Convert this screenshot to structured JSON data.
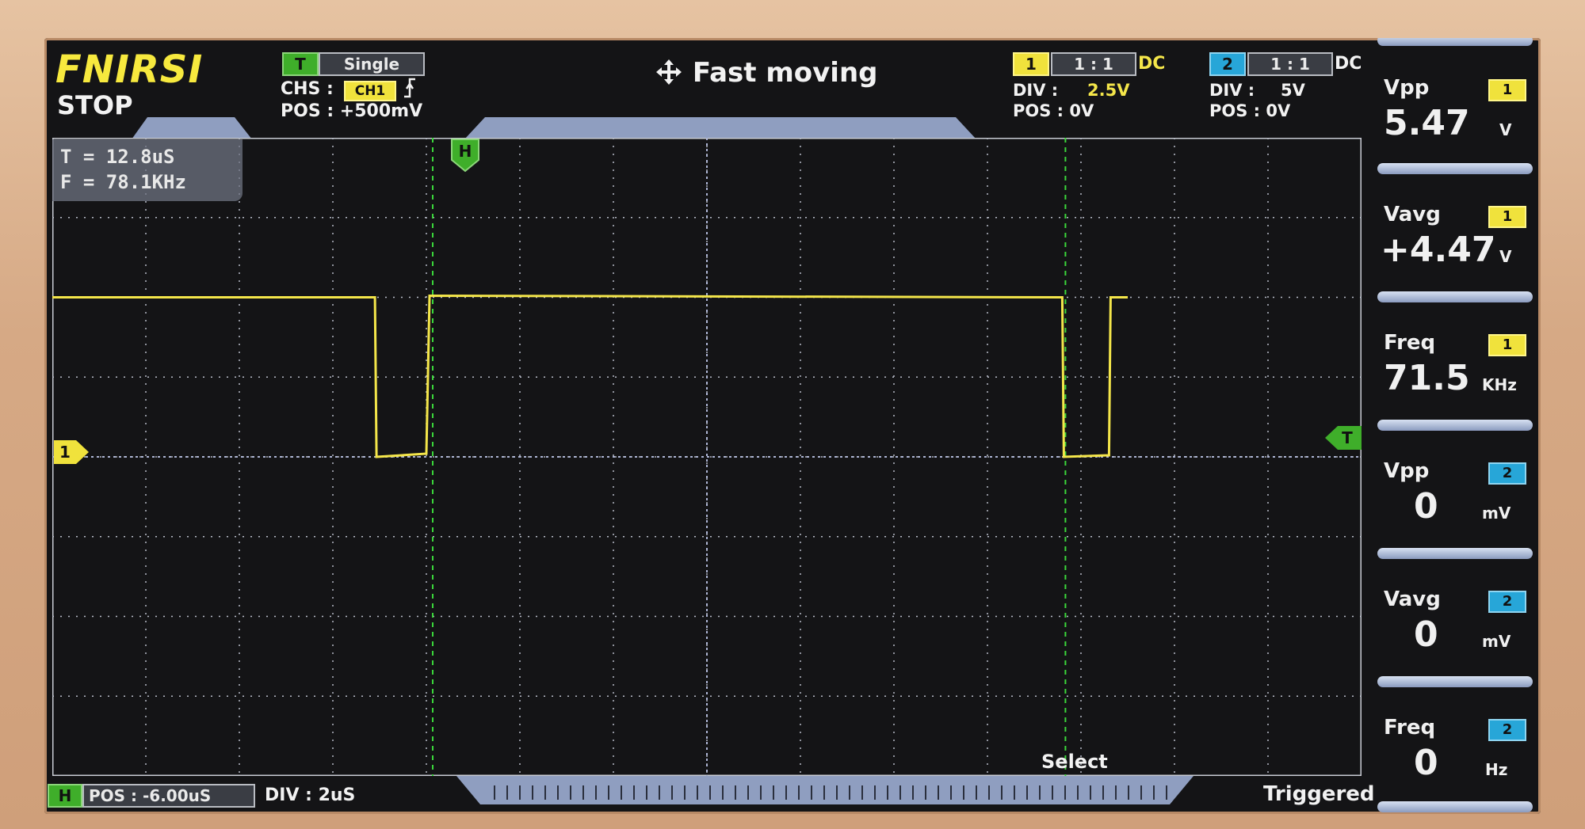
{
  "header": {
    "brand": "FNIRSI",
    "run_state": "STOP",
    "center_title": "Fast moving",
    "center_icon": "move-arrows-icon"
  },
  "trigger": {
    "tag": "T",
    "mode": "Single",
    "source_label": "CHS :",
    "source_value": "CH1",
    "edge_icon": "rising-edge-icon",
    "position": "POS : +500mV"
  },
  "channel1": {
    "number": "1",
    "probe": "1 : 1",
    "coupling": "DC",
    "div_label": "DIV :",
    "div_value": "2.5V",
    "position": "POS : 0V",
    "color": "#f4e64a"
  },
  "channel2": {
    "number": "2",
    "probe": "1 : 1",
    "coupling": "DC",
    "div_label": "DIV :",
    "div_value": "5V",
    "position": "POS : 0V",
    "color": "#27a6d8"
  },
  "cursor_measure": {
    "period": "T = 12.8uS",
    "frequency": "F = 78.1KHz"
  },
  "markers": {
    "cursor_h": "H",
    "ch1_ground": "1",
    "trigger_level": "T",
    "select_label": "Select"
  },
  "measurements": [
    {
      "label": "Vpp",
      "channel": "1",
      "value": "5.47",
      "unit": "V"
    },
    {
      "label": "Vavg",
      "channel": "1",
      "value": "+4.47",
      "unit": "V"
    },
    {
      "label": "Freq",
      "channel": "1",
      "value": "71.5",
      "unit": "KHz"
    },
    {
      "label": "Vpp",
      "channel": "2",
      "value": "0",
      "unit": "mV"
    },
    {
      "label": "Vavg",
      "channel": "2",
      "value": "0",
      "unit": "mV"
    },
    {
      "label": "Freq",
      "channel": "2",
      "value": "0",
      "unit": "Hz"
    }
  ],
  "horizontal": {
    "tag": "H",
    "position": "POS : -6.00uS",
    "division": "DIV : 2uS"
  },
  "status": "Triggered",
  "colors": {
    "trace": "#f4e64a",
    "cursor": "#3bd83a",
    "grid": "#b8bcc8",
    "background": "#141416"
  },
  "waveform": {
    "high_level_div": 2,
    "low_level_div": 0,
    "transitions_div": [
      3.45,
      4.0,
      10.8,
      11.3,
      11.5
    ]
  }
}
